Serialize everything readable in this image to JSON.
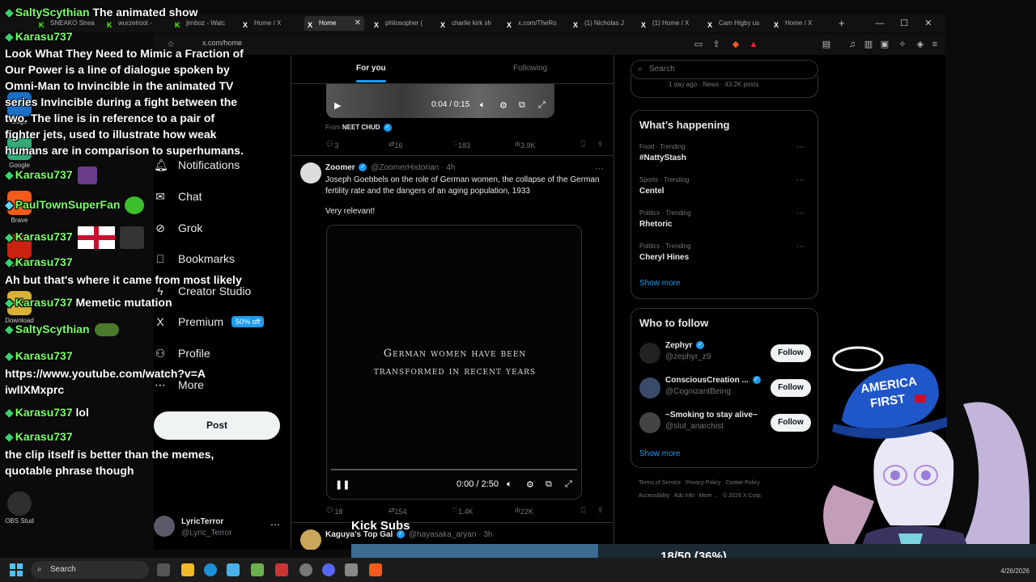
{
  "browser": {
    "tabs": [
      {
        "label": "SNEAKO Strea",
        "icon": "kick-icon"
      },
      {
        "label": "wurzelroot - ",
        "icon": "kick-icon"
      },
      {
        "label": "jimboz - Watc",
        "icon": "kick-icon"
      },
      {
        "label": "Home / X",
        "icon": "x-icon"
      },
      {
        "label": "Home",
        "icon": "x-icon"
      },
      {
        "label": "philosopher (",
        "icon": "x-icon"
      },
      {
        "label": "charlie kirk sh",
        "icon": "x-icon"
      },
      {
        "label": "x.com/TheRo",
        "icon": "x-icon"
      },
      {
        "label": "(1) Nicholas J",
        "icon": "x-icon"
      },
      {
        "label": "(1) Home / X",
        "icon": "x-icon"
      },
      {
        "label": "Cam Higby us",
        "icon": "x-icon"
      },
      {
        "label": "Home / X",
        "icon": "x-icon"
      }
    ],
    "new_tab": "+",
    "url": "x.com/home"
  },
  "nav": {
    "items": [
      {
        "label": "Notifications",
        "icon": "bell-icon"
      },
      {
        "label": "Chat",
        "icon": "chat-icon"
      },
      {
        "label": "Grok",
        "icon": "grok-icon"
      },
      {
        "label": "Bookmarks",
        "icon": "bookmark-icon"
      },
      {
        "label": "Creator Studio",
        "icon": "lightning-icon"
      },
      {
        "label": "Premium",
        "icon": "x-icon"
      },
      {
        "label": "Profile",
        "icon": "person-icon"
      },
      {
        "label": "More",
        "icon": "more-circle-icon"
      }
    ],
    "premium_badge": "50% off",
    "post_button": "Post",
    "account": {
      "name": "LyricTerror",
      "handle": "@Lyric_Terror"
    }
  },
  "feed": {
    "tabs": [
      "For you",
      "Following"
    ],
    "tweet1": {
      "video_time": "0:04 / 0:15",
      "from_prefix": "From",
      "from_name": "NEET CHUD",
      "replies": "3",
      "reposts": "16",
      "likes": "183",
      "views": "3.9K"
    },
    "tweet2": {
      "name": "Zoomer",
      "handle": "@ZoomerHistorian",
      "time": "4h",
      "text": "Joseph Goebbels on the role of German women, the collapse of the German fertility rate and the dangers of an aging population, 1933",
      "text2": "Very relevant!",
      "video_caption_1": "German women have been",
      "video_caption_2": "transformed in recent years",
      "video_time": "0:00 / 2:50",
      "replies": "18",
      "reposts": "154",
      "likes": "1.4K",
      "views": "22K"
    },
    "tweet3": {
      "name": "Kaguya's Top Gal",
      "handle": "@hayasaka_aryan",
      "time": "3h"
    }
  },
  "sidebar": {
    "search_placeholder": "Search",
    "news_meta": "1 day ago · News · 43.2K posts",
    "happening_title": "What’s happening",
    "trends": [
      {
        "category": "Food · Trending",
        "name": "#NattyStash"
      },
      {
        "category": "Sports · Trending",
        "name": "Centel"
      },
      {
        "category": "Politics · Trending",
        "name": "Rhetoric"
      },
      {
        "category": "Politics · Trending",
        "name": "Cheryl Hines"
      }
    ],
    "show_more": "Show more",
    "follow_title": "Who to follow",
    "follow": [
      {
        "name": "Zephyr",
        "handle": "@zephyr_z9",
        "button": "Follow"
      },
      {
        "name": "ConsciousCreation ...",
        "handle": "@CognizantBeing",
        "button": "Follow"
      },
      {
        "name": "~Smoking to stay alive~",
        "handle": "@slut_anarchist",
        "button": "Follow"
      }
    ],
    "footer": [
      "Terms of Service",
      "Privacy Policy",
      "Cookie Policy",
      "Accessibility",
      "Ads info",
      "More ...",
      "© 2026 X Corp."
    ]
  },
  "chat": [
    {
      "user": "SaltyScythian",
      "text": "The animated show"
    },
    {
      "user": "Karasu737",
      "text": ""
    },
    {
      "user": "",
      "text": "Look What They Need to Mimic a Fraction of Our Power is a line of dialogue spoken by Omni-Man to Invincible in the animated TV series Invincible during a fight between the two. The line is in reference to a pair of fighter jets, used to illustrate how weak humans are in comparison to superhumans."
    },
    {
      "user": "Karasu737",
      "text": ""
    },
    {
      "user": "PaulTownSuperFan",
      "text": ""
    },
    {
      "user": "Karasu737",
      "text": ""
    },
    {
      "user": "Karasu737",
      "text": ""
    },
    {
      "user": "",
      "text": "Ah but that's where it came from most likely"
    },
    {
      "user": "Karasu737",
      "text": "Memetic mutation"
    },
    {
      "user": "SaltyScythian",
      "text": ""
    },
    {
      "user": "Karasu737",
      "text": ""
    },
    {
      "user": "",
      "text": "https://www.youtube.com/watch?v=AiwlIXMxprc"
    },
    {
      "user": "Karasu737",
      "text": "lol"
    },
    {
      "user": "Karasu737",
      "text": ""
    },
    {
      "user": "",
      "text": "the clip itself is better than the memes, quotable phrase though"
    }
  ],
  "desktop_icons": [
    "Edge",
    "Google",
    "Brave",
    "Opera G",
    "Download",
    "OBS Stud"
  ],
  "overlay": {
    "kick_label": "Kick Subs",
    "subs_text": "18/50 (36%)",
    "subs_progress": 0.36,
    "hat_text_1": "AMERICA",
    "hat_text_2": "FIRST"
  },
  "taskbar": {
    "search": "Search",
    "date": "4/26/2026"
  },
  "colors": {
    "accent": "#1d9bf0",
    "chat_user": "#7dff6b",
    "sub_fill": "#3c6c92"
  }
}
